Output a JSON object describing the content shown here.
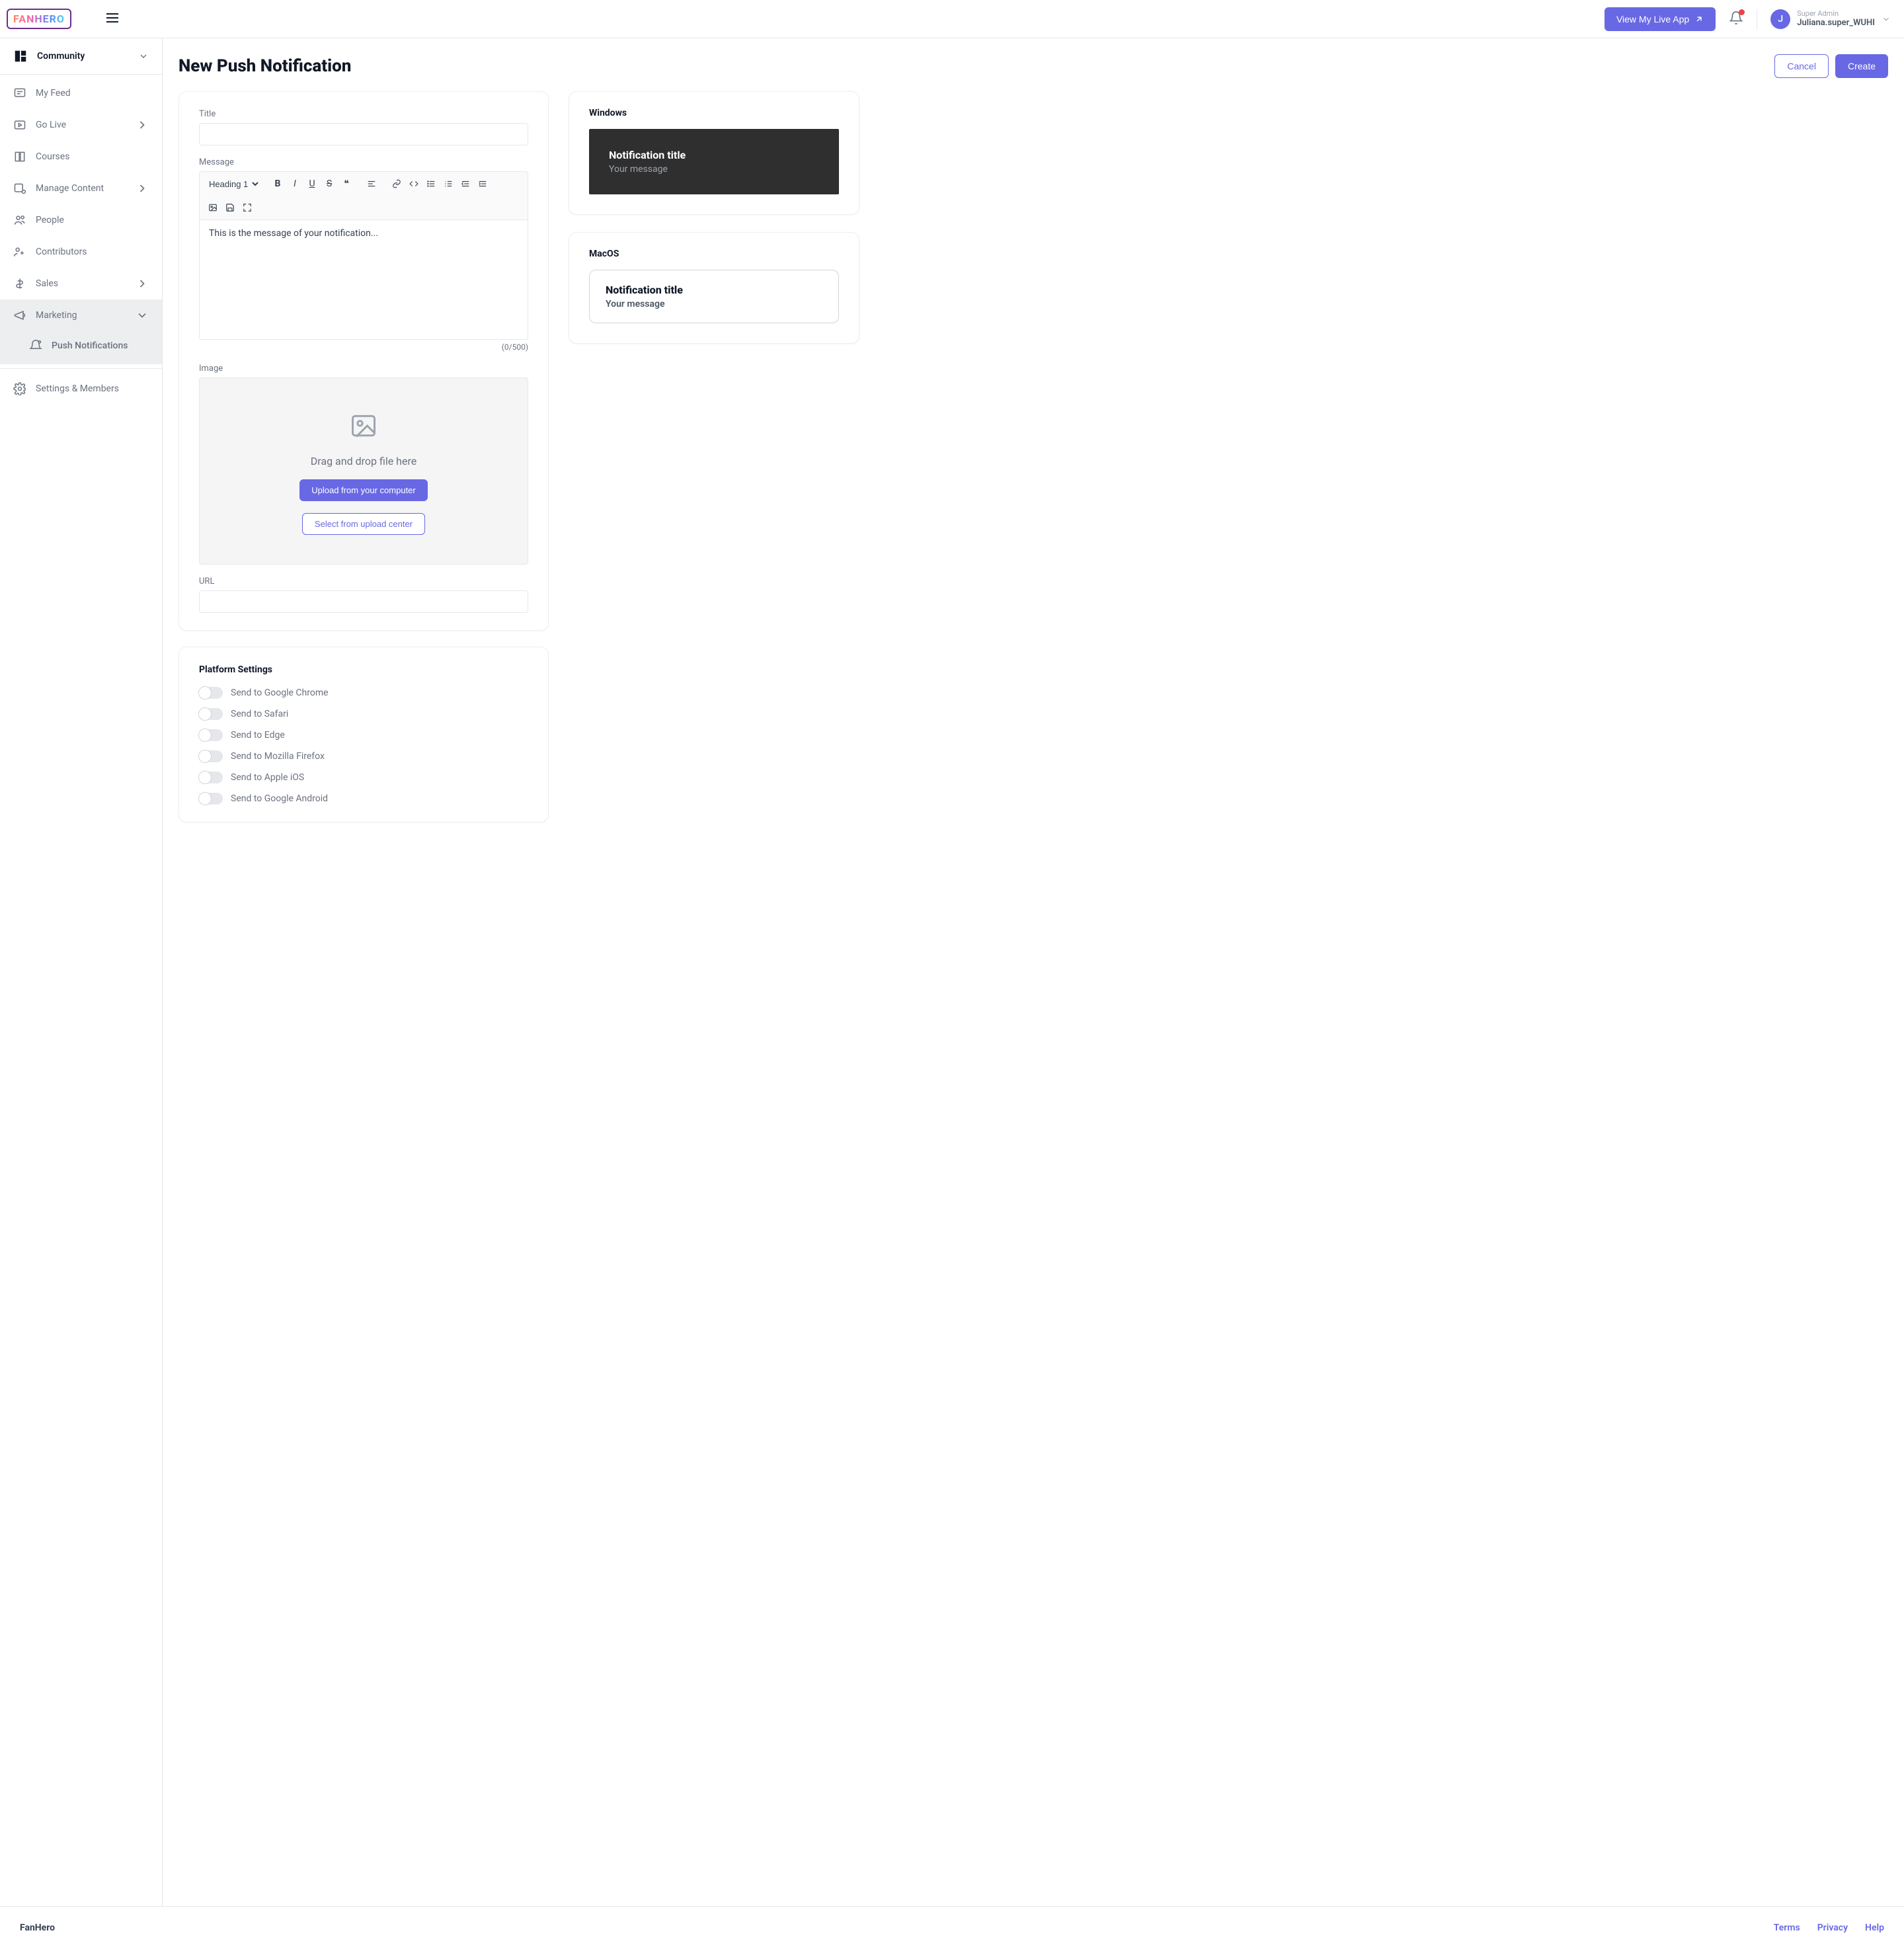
{
  "header": {
    "logo_text": "FANHERO",
    "view_app": "View My Live App",
    "user": {
      "initial": "J",
      "role": "Super Admin",
      "name": "Juliana.super_WUHI"
    }
  },
  "sidebar": {
    "community": "Community",
    "items": {
      "feed": "My Feed",
      "golive": "Go Live",
      "courses": "Courses",
      "content": "Manage Content",
      "people": "People",
      "contributors": "Contributors",
      "sales": "Sales",
      "marketing": "Marketing",
      "push": "Push Notifications",
      "settings": "Settings & Members"
    }
  },
  "page": {
    "title": "New Push Notification",
    "cancel": "Cancel",
    "create": "Create",
    "labels": {
      "title": "Title",
      "message": "Message",
      "image": "Image",
      "url": "URL"
    },
    "editor_heading_option": "Heading 1",
    "editor_placeholder": "This is the message of your notification...",
    "counter": "(0/500)",
    "dropzone": {
      "text": "Drag and drop file here",
      "upload": "Upload from your computer",
      "select": "Select from upload center"
    }
  },
  "platform": {
    "title": "Platform Settings",
    "toggles": [
      "Send to Google Chrome",
      "Send to Safari",
      "Send to Edge",
      "Send to Mozilla Firefox",
      "Send to Apple iOS",
      "Send to Google Android"
    ]
  },
  "previews": {
    "windows_label": "Windows",
    "macos_label": "MacOS",
    "title": "Notification title",
    "message": "Your message"
  },
  "footer": {
    "brand": "FanHero",
    "links": [
      "Terms",
      "Privacy",
      "Help"
    ]
  }
}
